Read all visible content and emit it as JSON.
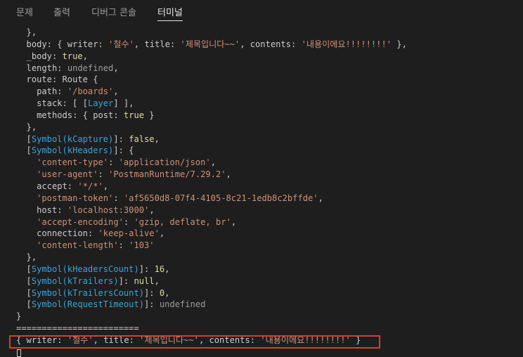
{
  "tabs": [
    {
      "label": "문제"
    },
    {
      "label": "출력"
    },
    {
      "label": "디버그 콘솔"
    },
    {
      "label": "터미널",
      "active": true
    }
  ],
  "terminal": {
    "lines": [
      "  },",
      "  body: { writer: '철수', title: '제목입니다~~', contents: '내용이에요!!!!!!!!' },",
      "  _body: true,",
      "  length: undefined,",
      "  route: Route {",
      "    path: '/boards',",
      "    stack: [ [Layer] ],",
      "    methods: { post: true }",
      "  },",
      "  [Symbol(kCapture)]: false,",
      "  [Symbol(kHeaders)]: {",
      "    'content-type': 'application/json',",
      "    'user-agent': 'PostmanRuntime/7.29.2',",
      "    accept: '*/*',",
      "    'postman-token': 'af5650d8-07f4-4105-8c21-1edb8c2bffde',",
      "    host: 'localhost:3000',",
      "    'accept-encoding': 'gzip, deflate, br',",
      "    connection: 'keep-alive',",
      "    'content-length': '103'",
      "  },",
      "  [Symbol(kHeadersCount)]: 16,",
      "  [Symbol(kTrailers)]: null,",
      "  [Symbol(kTrailersCount)]: 0,",
      "  [Symbol(RequestTimeout)]: undefined",
      "}",
      "========================",
      "{ writer: '철수', title: '제목입니다~~', contents: '내용이에요!!!!!!!!' }"
    ]
  },
  "colors": {
    "background": "#1e1e1e",
    "text": "#cccccc",
    "string": "#ce9178",
    "keyword": "#dcdcaa",
    "symbol": "#3ba3d8",
    "undefined": "#9d9d9d",
    "highlight_border": "#e03b24"
  }
}
